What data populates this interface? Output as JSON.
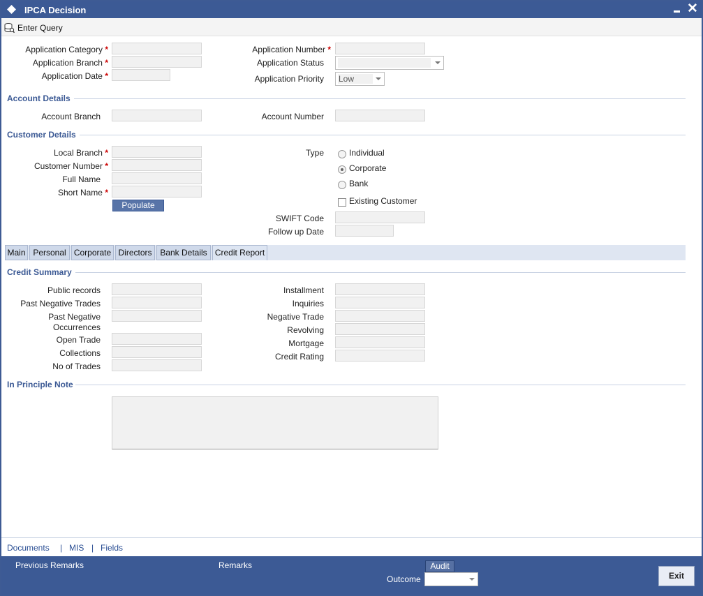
{
  "window": {
    "title": "IPCA Decision",
    "close_glyph": "✕"
  },
  "toolbar": {
    "enter_query": "Enter Query"
  },
  "header": {
    "application_category": "Application Category",
    "application_branch": "Application Branch",
    "application_date": "Application Date",
    "application_number": "Application Number",
    "application_status": "Application Status",
    "application_priority": "Application Priority",
    "priority_value": "Low",
    "required": "*"
  },
  "account": {
    "title": "Account Details",
    "branch": "Account Branch",
    "number": "Account Number"
  },
  "customer": {
    "title": "Customer Details",
    "local_branch": "Local Branch",
    "customer_number": "Customer Number",
    "full_name": "Full Name",
    "short_name": "Short Name",
    "populate": "Populate",
    "type": "Type",
    "type_options": [
      "Individual",
      "Corporate",
      "Bank"
    ],
    "type_selected": "Corporate",
    "existing_customer": "Existing Customer",
    "swift_code": "SWIFT Code",
    "follow_up_date": "Follow up Date"
  },
  "tabs": [
    "Main",
    "Personal",
    "Corporate",
    "Directors",
    "Bank Details",
    "Credit Report"
  ],
  "active_tab": "Credit Report",
  "credit": {
    "title": "Credit Summary",
    "public_records": "Public records",
    "past_negative_trades": "Past Negative Trades",
    "past_negative_occ_1": "Past Negative",
    "past_negative_occ_2": "Occurrences",
    "open_trade": "Open Trade",
    "collections": "Collections",
    "no_of_trades": "No of Trades",
    "installment": "Installment",
    "inquiries": "Inquiries",
    "negative_trade": "Negative Trade",
    "revolving": "Revolving",
    "mortgage": "Mortgage",
    "credit_rating": "Credit Rating"
  },
  "note": {
    "title": "In Principle Note"
  },
  "links": {
    "documents": "Documents",
    "mis": "MIS",
    "fields": "Fields",
    "sep": "|"
  },
  "footer": {
    "previous_remarks": "Previous Remarks",
    "remarks": "Remarks",
    "audit": "Audit",
    "outcome": "Outcome",
    "exit": "Exit"
  },
  "colors": {
    "brand": "#3c5a95",
    "required": "#cc0000",
    "section": "#3c5a95"
  }
}
